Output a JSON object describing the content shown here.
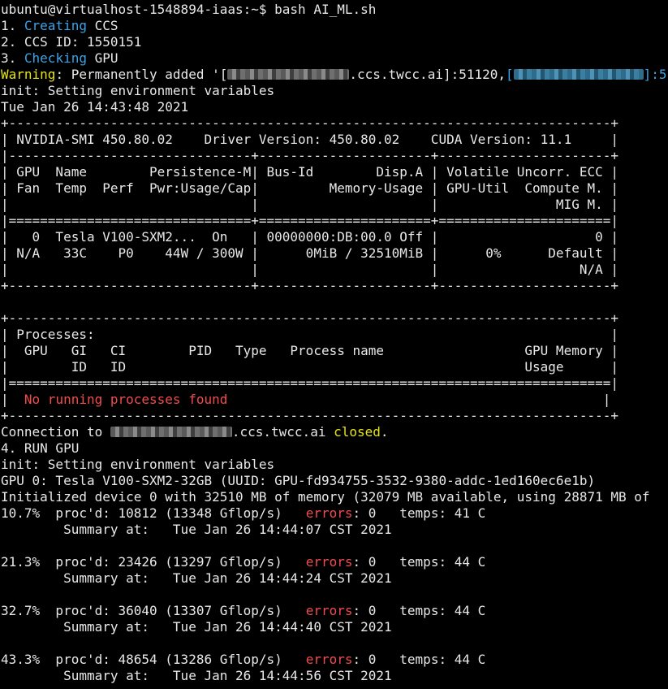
{
  "terminal": {
    "prompt": "ubuntu@virtualhost-1548894-iaas:~$ bash AI_ML.sh",
    "steps": {
      "s1_prefix": "1. ",
      "s1_word": "Creating",
      "s1_rest": " CCS",
      "s2": "2. CCS ID: 1550151",
      "s3_prefix": "3. ",
      "s3_word": "Checking",
      "s3_rest": " GPU"
    },
    "warning": {
      "label": "Warning",
      "text_a": ": Permanently added '[",
      "text_b": ".ccs.twcc.ai]:51120,",
      "text_c": "[",
      "text_d": "]:5"
    },
    "init1": "init: Setting environment variables",
    "date": "Tue Jan 26 14:43:48 2021",
    "nvsmi": [
      "+-----------------------------------------------------------------------------+",
      "| NVIDIA-SMI 450.80.02    Driver Version: 450.80.02    CUDA Version: 11.1     |",
      "|-------------------------------+----------------------+----------------------+",
      "| GPU  Name        Persistence-M| Bus-Id        Disp.A | Volatile Uncorr. ECC |",
      "| Fan  Temp  Perf  Pwr:Usage/Cap|         Memory-Usage | GPU-Util  Compute M. |",
      "|                               |                      |               MIG M. |",
      "|===============================+======================+======================|",
      "|   0  Tesla V100-SXM2...  On   | 00000000:DB:00.0 Off |                    0 |",
      "| N/A   33C    P0    44W / 300W |      0MiB / 32510MiB |      0%      Default |",
      "|                               |                      |                  N/A |",
      "+-------------------------------+----------------------+----------------------+",
      "",
      "+-----------------------------------------------------------------------------+",
      "| Processes:                                                                  |",
      "|  GPU   GI   CI        PID   Type   Process name                  GPU Memory |",
      "|        ID   ID                                                   Usage      |",
      "|=============================================================================|"
    ],
    "proc_none_pre": "|  ",
    "proc_none": "No running processes found",
    "proc_none_post": "                                                |",
    "nvsmi_end": "+-----------------------------------------------------------------------------+",
    "conn_a": "Connection to ",
    "conn_b": ".ccs.twcc.ai ",
    "conn_closed": "closed",
    "conn_c": ".",
    "run_gpu": "4. RUN GPU",
    "init2": "init: Setting environment variables",
    "gpu0": "GPU 0: Tesla V100-SXM2-32GB (UUID: GPU-fd934755-3532-9380-addc-1ed160ec6e1b)",
    "initialized": "Initialized device 0 with 32510 MB of memory (32079 MB available, using 28871 MB of",
    "progress": [
      {
        "pct_line": "10.7%  proc'd: 10812 (13348 Gflop/s)   ",
        "err_label": "errors",
        "err_rest": ": 0   temps: 41 C",
        "summary": "        Summary at:   Tue Jan 26 14:44:07 CST 2021"
      },
      {
        "pct_line": "21.3%  proc'd: 23426 (13297 Gflop/s)   ",
        "err_label": "errors",
        "err_rest": ": 0   temps: 44 C",
        "summary": "        Summary at:   Tue Jan 26 14:44:24 CST 2021"
      },
      {
        "pct_line": "32.7%  proc'd: 36040 (13307 Gflop/s)   ",
        "err_label": "errors",
        "err_rest": ": 0   temps: 44 C",
        "summary": "        Summary at:   Tue Jan 26 14:44:40 CST 2021"
      },
      {
        "pct_line": "43.3%  proc'd: 48654 (13286 Gflop/s)   ",
        "err_label": "errors",
        "err_rest": ": 0   temps: 44 C",
        "summary": "        Summary at:   Tue Jan 26 14:44:56 CST 2021"
      }
    ]
  }
}
